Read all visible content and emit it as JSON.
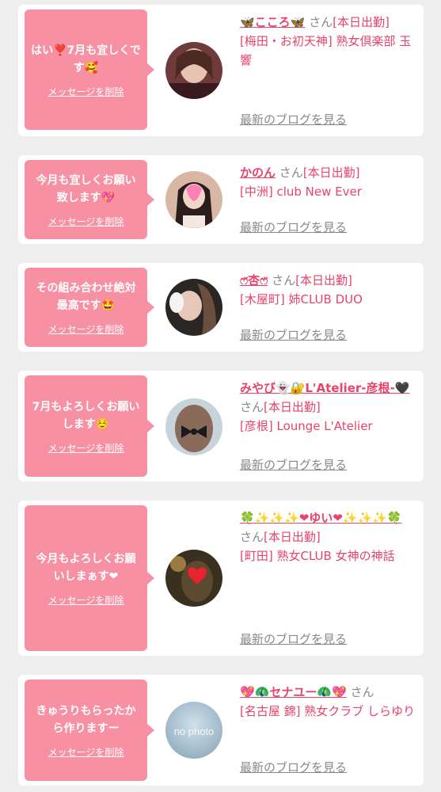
{
  "delete_label": "メッセージを削除",
  "blog_label": "最新のブログを見る",
  "cards": [
    {
      "message": "はい❣️7月も宜しくです🥰",
      "name": "🦋こころ🦋",
      "san": "さん",
      "status": "[本日出勤]",
      "store": "[梅田・お初天神] 熟女倶楽部 玉響"
    },
    {
      "message": "今月も宜しくお願い致します💖",
      "name": "かのん",
      "san": "さん",
      "status": "[本日出勤]",
      "store": "[中洲] club New Ever"
    },
    {
      "message": "その組み合わせ絶対最高です🤩",
      "name": "ෆ̈杏ෆ̈",
      "san": "さん",
      "status": "[本日出勤]",
      "store": "[木屋町] 姉CLUB DUO"
    },
    {
      "message": "7月もよろしくお願いします☺️",
      "name": "みやび👻🔐L'Atelier-彦根-🖤",
      "san": "さん",
      "status": "[本日出勤]",
      "store": "[彦根] Lounge L'Atelier"
    },
    {
      "message": "今月もよろしくお願いしまぁす❤",
      "name": "🍀✨✨✨❤ゆい❤✨✨✨🍀",
      "san": "さん",
      "status": "[本日出勤]",
      "store": "[町田] 熟女CLUB 女神の神話"
    },
    {
      "message": "きゅうりもらったから作りますー",
      "name": "💖🦚セナユー🦚💖",
      "san": "さん",
      "status": "",
      "store": "[名古屋 錦] 熟女クラブ しらゆり"
    }
  ],
  "avatar_placeholder_text": "no photo",
  "colors": {
    "bubble": "#f890a4",
    "accent": "#e8436a",
    "muted": "#888888",
    "background": "#eeeeee"
  }
}
